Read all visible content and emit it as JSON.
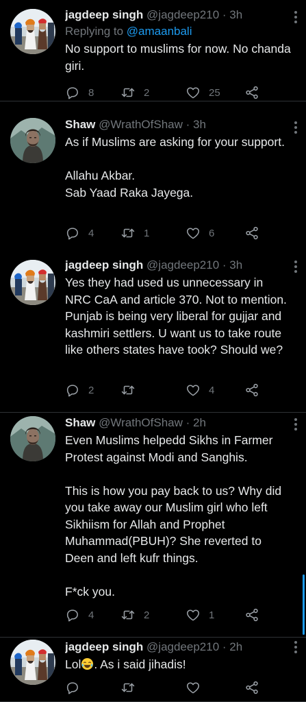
{
  "tweets": [
    {
      "name": "jagdeep singh",
      "handle": "@jagdeep210",
      "sep": " · ",
      "time": "3h",
      "replying_prefix": "Replying to ",
      "replying_to": "@amaanbali",
      "text": "No support to muslims for now. No chanda giri.",
      "replies": "8",
      "retweets": "2",
      "likes": "25"
    },
    {
      "name": "Shaw",
      "handle": "@WrathOfShaw",
      "sep": " · ",
      "time": "3h",
      "text": "As if Muslims are asking for your support.\n\nAllahu Akbar.\nSab Yaad Raka Jayega.",
      "replies": "4",
      "retweets": "1",
      "likes": "6"
    },
    {
      "name": "jagdeep singh",
      "handle": "@jagdeep210",
      "sep": " · ",
      "time": "3h",
      "text": "Yes they had used us unnecessary in NRC CaA and article 370. Not to mention. Punjab is being very liberal for gujjar and kashmiri settlers. U want us to take route like others states have took? Should we?",
      "replies": "2",
      "retweets": "",
      "likes": "4"
    },
    {
      "name": "Shaw",
      "handle": "@WrathOfShaw",
      "sep": " · ",
      "time": "2h",
      "text": "Even Muslims helpedd Sikhs in Farmer Protest against Modi and Sanghis.\n\nThis is how you pay back to us? Why did you take away our Muslim girl who left Sikhiism for Allah and Prophet Muhammad(PBUH)? She reverted to Deen and left kufr things.\n\nF*ck you.",
      "replies": "4",
      "retweets": "2",
      "likes": "1"
    },
    {
      "name": "jagdeep singh",
      "handle": "@jagdeep210",
      "sep": " · ",
      "time": "2h",
      "text_before_emoji": "Lol",
      "text_after_emoji": ". As i said jihadis!",
      "replies": "",
      "retweets": "",
      "likes": ""
    }
  ],
  "icons": {
    "reply": "reply-icon",
    "retweet": "retweet-icon",
    "like": "heart-icon",
    "share": "share-icon",
    "more": "more-vertical-icon",
    "emoji": "face-with-tears-of-joy-emoji"
  },
  "colors": {
    "background": "#000000",
    "text": "#e7e9ea",
    "secondary": "#71767b",
    "link": "#1d9bf0",
    "divider": "#2f3336"
  }
}
